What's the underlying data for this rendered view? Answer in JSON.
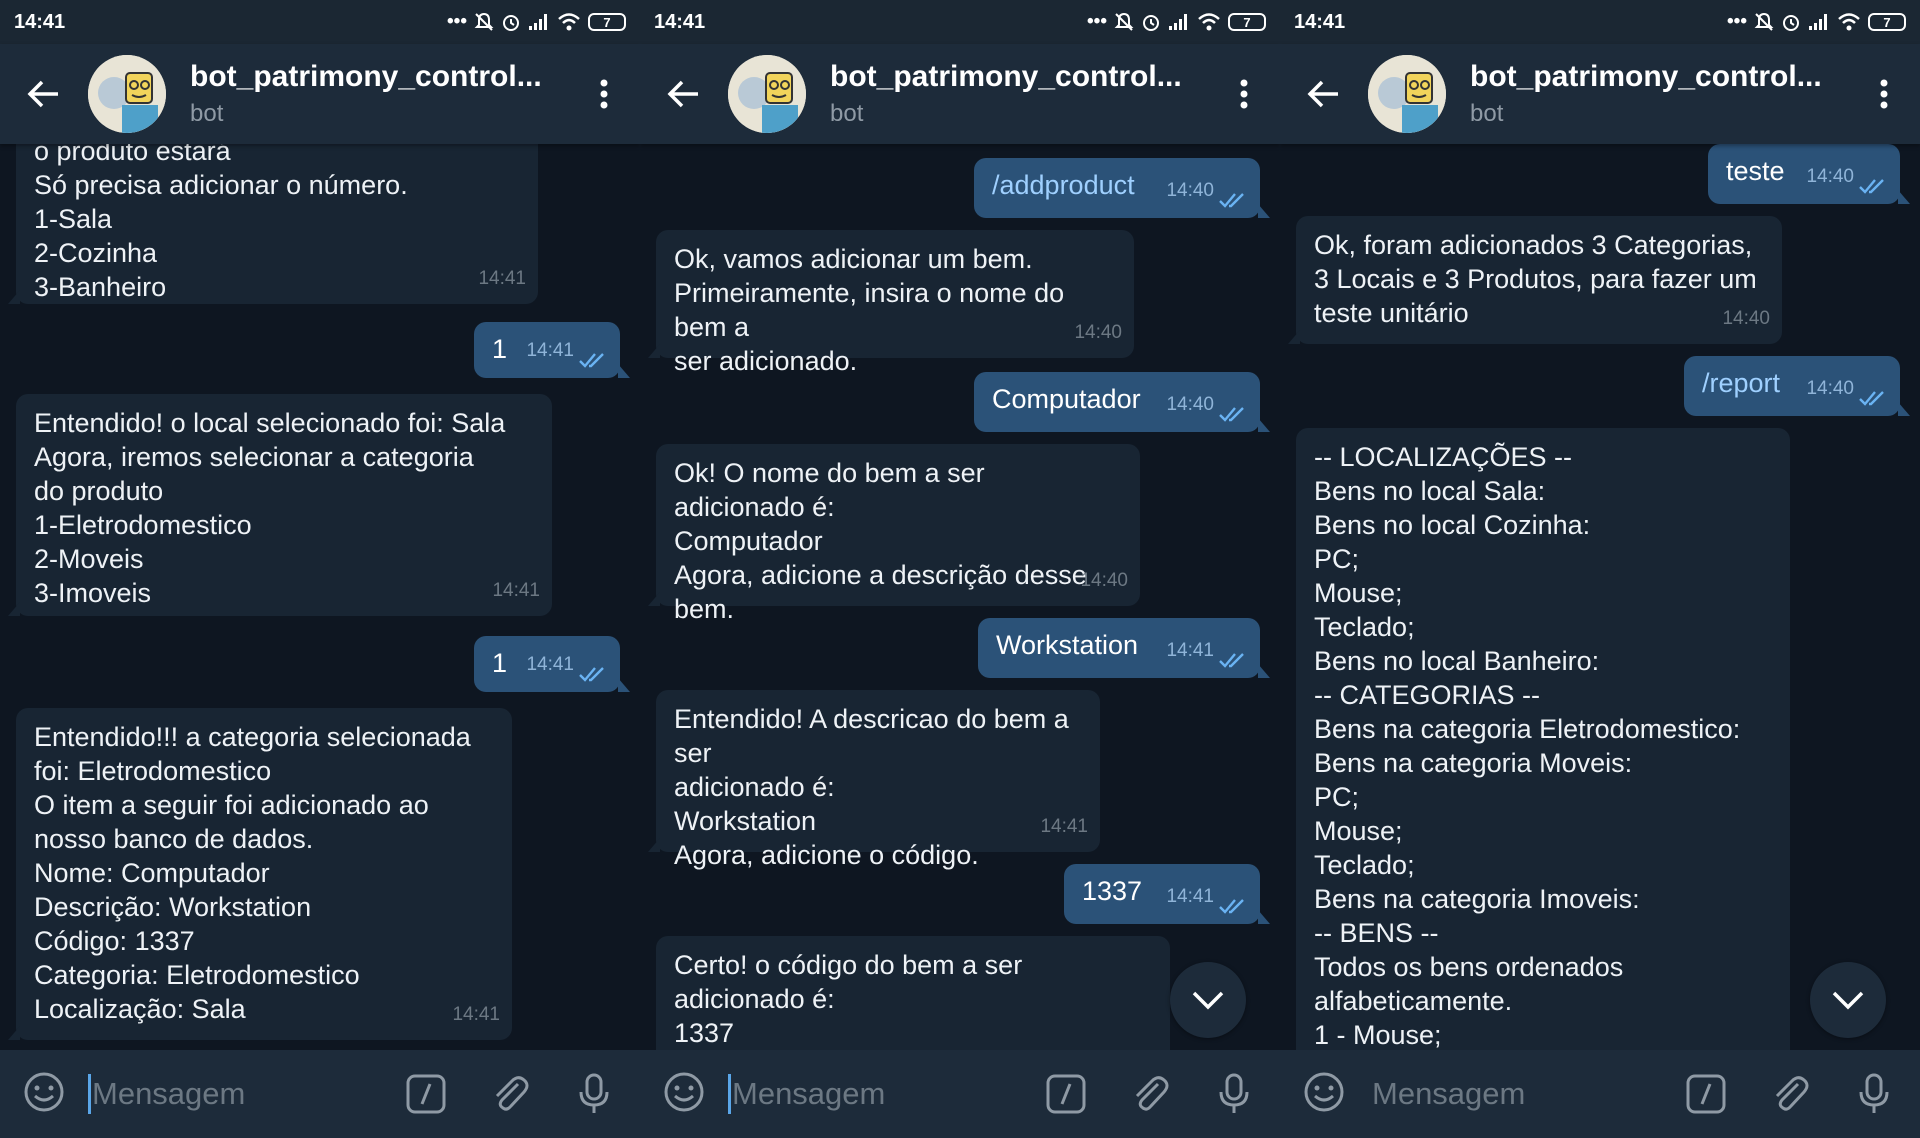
{
  "colors": {
    "background": "#0e1621",
    "bar": "#1d2b3a",
    "incoming_bubble": "#182533",
    "outgoing_bubble": "#2b5278",
    "accent": "#5aa6e8"
  },
  "screens": [
    {
      "status_time": "14:41",
      "battery": "7",
      "chat_title": "bot_patrimony_control...",
      "chat_subtitle": "bot",
      "input_placeholder": "Mensagem",
      "messages": [
        {
          "text": "o produto estará\nSó precisa adicionar o número.\n1-Sala\n2-Cozinha\n3-Banheiro",
          "time": "14:41"
        },
        {
          "text": "1",
          "time": "14:41"
        },
        {
          "text": "Entendido! o local selecionado foi: Sala\nAgora, iremos selecionar a categoria\ndo produto\n1-Eletrodomestico\n2-Moveis\n3-Imoveis",
          "time": "14:41"
        },
        {
          "text": "1",
          "time": "14:41"
        },
        {
          "text": "Entendido!!! a categoria selecionada\nfoi: Eletrodomestico\nO item a seguir foi adicionado ao\nnosso banco de dados.\nNome: Computador\nDescrição: Workstation\nCódigo: 1337\nCategoria: Eletrodomestico\nLocalização: Sala",
          "time": "14:41"
        }
      ]
    },
    {
      "status_time": "14:41",
      "battery": "7",
      "chat_title": "bot_patrimony_control...",
      "chat_subtitle": "bot",
      "input_placeholder": "Mensagem",
      "messages": [
        {
          "text": "/addproduct",
          "time": "14:40"
        },
        {
          "text": "Ok, vamos adicionar um bem.\nPrimeiramente, insira o nome do bem a\nser adicionado.",
          "time": "14:40"
        },
        {
          "text": "Computador",
          "time": "14:40"
        },
        {
          "text": "Ok! O nome do bem a ser adicionado é:\nComputador\n Agora, adicione a descrição desse\nbem.",
          "time": "14:40"
        },
        {
          "text": "Workstation",
          "time": "14:41"
        },
        {
          "text": "Entendido! A descricao do bem a ser\nadicionado é:\nWorkstation\nAgora, adicione o código.",
          "time": "14:41"
        },
        {
          "text": "1337",
          "time": "14:41"
        },
        {
          "text": "Certo! o código do bem a ser\nadicionado é:\n1337",
          "time": ""
        }
      ]
    },
    {
      "status_time": "14:41",
      "battery": "7",
      "chat_title": "bot_patrimony_control...",
      "chat_subtitle": "bot",
      "input_placeholder": "Mensagem",
      "messages": [
        {
          "text": "teste",
          "time": "14:40"
        },
        {
          "text": "Ok, foram adicionados 3 Categorias,\n3 Locais e 3 Produtos, para fazer um\nteste unitário",
          "time": "14:40"
        },
        {
          "text": "/report",
          "time": "14:40"
        },
        {
          "text": "-- LOCALIZAÇÕES --\nBens no local Sala:\nBens no local Cozinha:\nPC;\nMouse;\nTeclado;\nBens no local Banheiro:\n-- CATEGORIAS --\nBens na categoria Eletrodomestico:\nBens na categoria Moveis:\nPC;\nMouse;\nTeclado;\nBens na categoria Imoveis:\n-- BENS --\nTodos os bens ordenados\nalfabeticamente.\n1 - Mouse;",
          "time": ""
        }
      ]
    }
  ]
}
